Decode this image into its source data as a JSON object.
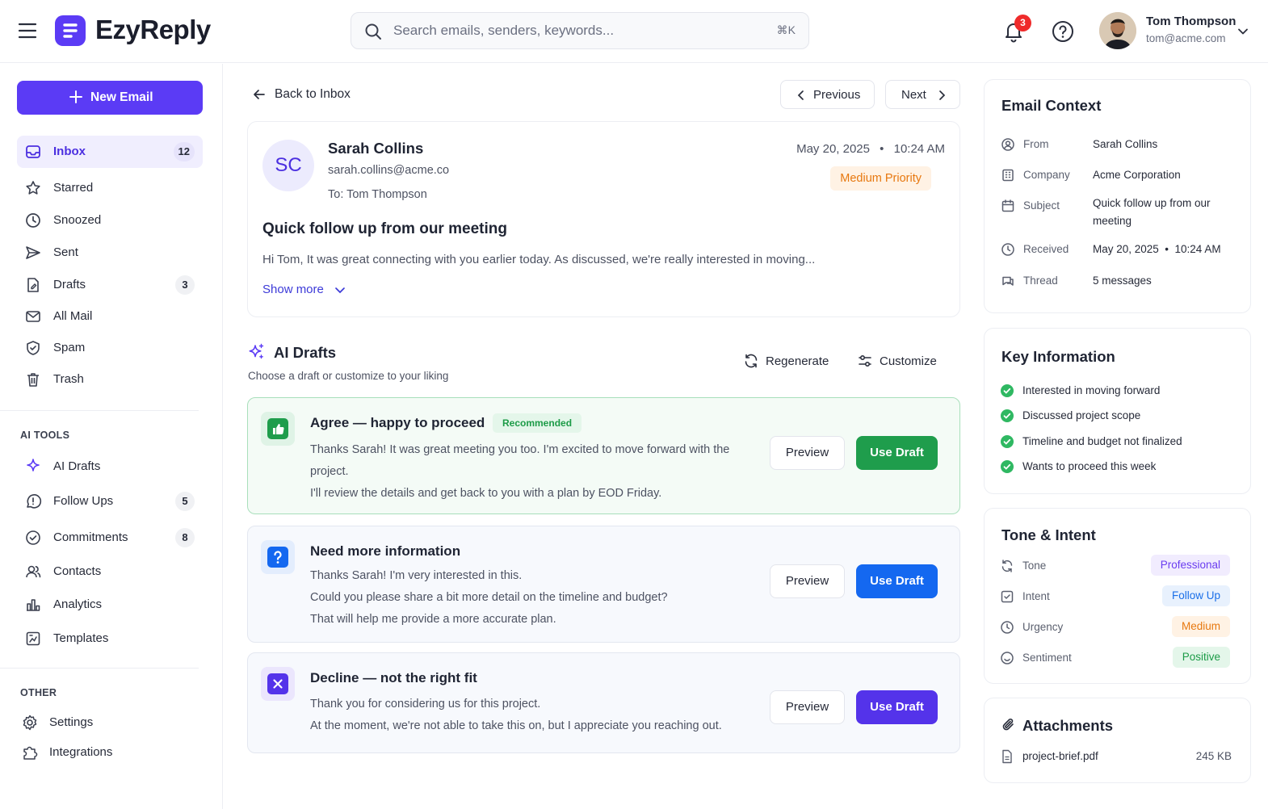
{
  "app": {
    "name": "EzyReply"
  },
  "search": {
    "placeholder": "Search emails, senders, keywords...",
    "shortcut": "⌘K"
  },
  "header": {
    "notification_count": "3",
    "user_name": "Tom Thompson",
    "user_email": "tom@acme.com"
  },
  "sidebar": {
    "new_email_label": "New Email",
    "mail_items": [
      {
        "label": "Inbox",
        "icon": "inbox-icon",
        "count": "12",
        "active": true
      },
      {
        "label": "Starred",
        "icon": "star-icon"
      },
      {
        "label": "Snoozed",
        "icon": "clock-icon"
      },
      {
        "label": "Sent",
        "icon": "send-icon"
      },
      {
        "label": "Drafts",
        "icon": "draft-icon",
        "count": "3"
      },
      {
        "label": "All Mail",
        "icon": "mail-icon"
      },
      {
        "label": "Spam",
        "icon": "shield-icon"
      },
      {
        "label": "Trash",
        "icon": "trash-icon"
      }
    ],
    "ai_tools_label": "AI TOOLS",
    "ai_items": [
      {
        "label": "AI Drafts",
        "icon": "sparkle-icon"
      },
      {
        "label": "Follow Ups",
        "icon": "follow-up-icon",
        "count": "5"
      },
      {
        "label": "Commitments",
        "icon": "check-circle-icon",
        "count": "8"
      },
      {
        "label": "Contacts",
        "icon": "contacts-icon"
      },
      {
        "label": "Analytics",
        "icon": "analytics-icon"
      },
      {
        "label": "Templates",
        "icon": "templates-icon"
      }
    ],
    "other_label": "OTHER",
    "other_items": [
      {
        "label": "Settings",
        "icon": "gear-icon"
      },
      {
        "label": "Integrations",
        "icon": "puzzle-icon"
      }
    ]
  },
  "nav": {
    "back_label": "Back to Inbox",
    "previous_label": "Previous",
    "next_label": "Next"
  },
  "email": {
    "initials": "SC",
    "sender_name": "Sarah Collins",
    "sender_email": "sarah.collins@acme.co",
    "to_line": "To: Tom Thompson",
    "date": "May 20, 2025",
    "time": "10:24 AM",
    "priority": "Medium Priority",
    "subject": "Quick follow up from our meeting",
    "preview": "Hi Tom, It was great connecting with you earlier today. As discussed, we're really interested in moving...",
    "show_more": "Show more"
  },
  "ai_drafts": {
    "title": "AI Drafts",
    "subtitle": "Choose a draft or customize to your liking",
    "regenerate_label": "Regenerate",
    "customize_label": "Customize",
    "preview_label": "Preview",
    "use_label": "Use Draft",
    "drafts": [
      {
        "title": "Agree — happy to proceed",
        "badge": "Recommended",
        "lines": [
          "Thanks Sarah! It was great meeting you too. I'm excited to move forward with the",
          "project.",
          "I'll review the details and get back to you with a plan by EOD Friday."
        ],
        "accent": "#1f9d4c"
      },
      {
        "title": "Need more information",
        "lines": [
          "Thanks Sarah! I'm very interested in this.",
          "Could you please share a bit more detail on the timeline and budget?",
          "That will help me provide a more accurate plan."
        ],
        "accent": "#1468f0"
      },
      {
        "title": "Decline — not the right fit",
        "lines": [
          "Thank you for considering us for this project.",
          "At the moment, we're not able to take this on, but I appreciate you reaching out."
        ],
        "accent": "#5433ea"
      }
    ]
  },
  "context": {
    "title": "Email Context",
    "rows": [
      {
        "key": "From",
        "value": "Sarah Collins",
        "icon": "user-circle-icon"
      },
      {
        "key": "Company",
        "value": "Acme Corporation",
        "icon": "building-icon"
      },
      {
        "key": "Subject",
        "value": "Quick follow up from our meeting",
        "icon": "calendar-icon"
      },
      {
        "key": "Received",
        "value": "May 20, 2025  •  10:24 AM",
        "icon": "clock-icon"
      },
      {
        "key": "Thread",
        "value": "5 messages",
        "icon": "thread-icon"
      }
    ]
  },
  "key_info": {
    "title": "Key Information",
    "items": [
      "Interested in moving forward",
      "Discussed project scope",
      "Timeline and budget not finalized",
      "Wants to proceed this week"
    ]
  },
  "tone": {
    "title": "Tone & Intent",
    "rows": [
      {
        "key": "Tone",
        "value": "Professional",
        "icon": "refresh-icon",
        "color": "#6a3df0",
        "bg": "#f1ecfe"
      },
      {
        "key": "Intent",
        "value": "Follow Up",
        "icon": "reply-box-icon",
        "color": "#1a6fe8",
        "bg": "#e8f1fd"
      },
      {
        "key": "Urgency",
        "value": "Medium",
        "icon": "clock-icon",
        "color": "#e7780f",
        "bg": "#fff2e4"
      },
      {
        "key": "Sentiment",
        "value": "Positive",
        "icon": "smile-icon",
        "color": "#1c9b47",
        "bg": "#e4f6ea"
      }
    ]
  },
  "attachments": {
    "title": "Attachments",
    "files": [
      {
        "name": "project-brief.pdf",
        "size": "245 KB"
      }
    ]
  },
  "colors": {
    "brand": "#5b3bf5",
    "green": "#1f9d4c",
    "blue": "#1468f0",
    "purple": "#5433ea"
  }
}
